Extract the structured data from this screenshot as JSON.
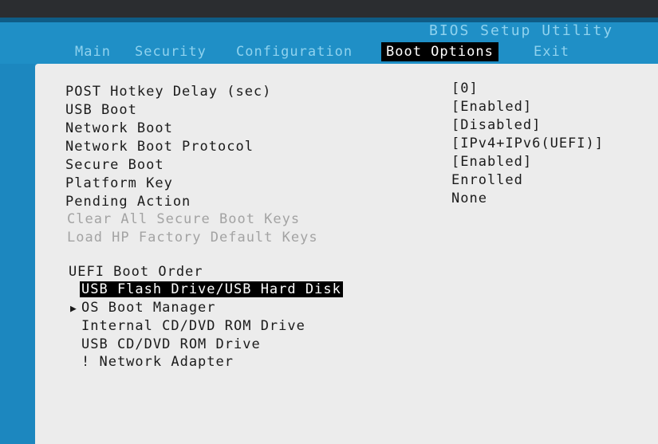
{
  "header": {
    "title": "BIOS Setup Utility"
  },
  "menu": {
    "tabs": [
      {
        "label": "Main"
      },
      {
        "label": "Security"
      },
      {
        "label": "Configuration"
      },
      {
        "label": "Boot Options"
      },
      {
        "label": "Exit"
      }
    ],
    "active": "Boot Options"
  },
  "settings": [
    {
      "label": "POST Hotkey Delay (sec)",
      "value": "[0]"
    },
    {
      "label": "USB Boot",
      "value": "[Enabled]"
    },
    {
      "label": "Network Boot",
      "value": "[Disabled]"
    },
    {
      "label": "Network Boot Protocol",
      "value": "[IPv4+IPv6(UEFI)]"
    },
    {
      "label": "Secure Boot",
      "value": "[Enabled]"
    },
    {
      "label": "Platform Key",
      "value": "Enrolled"
    },
    {
      "label": "Pending Action",
      "value": "None"
    }
  ],
  "actions": [
    {
      "label": "Clear All Secure Boot Keys"
    },
    {
      "label": "Load HP Factory Default Keys"
    }
  ],
  "boot_order": {
    "title": "UEFI Boot Order",
    "items": [
      {
        "label": "USB Flash Drive/USB Hard Disk"
      },
      {
        "label": "OS Boot Manager"
      },
      {
        "label": "Internal CD/DVD ROM Drive"
      },
      {
        "label": "USB CD/DVD ROM Drive"
      },
      {
        "label": "! Network Adapter"
      }
    ]
  }
}
